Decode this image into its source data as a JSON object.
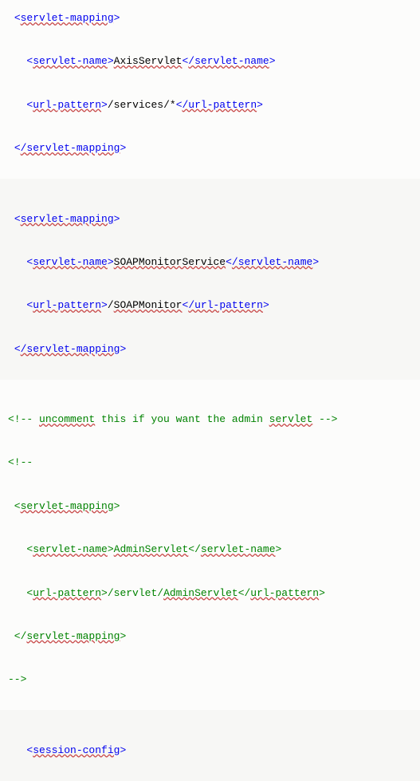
{
  "block1": {
    "open_sm": "servlet-mapping",
    "open_sn": "servlet-name",
    "sn_val": "AxisServlet",
    "close_sn": "/servlet-name",
    "open_up": "url-pattern",
    "up_val": "/services/*",
    "close_up": "/url-pattern",
    "close_sm": "/servlet-mapping"
  },
  "block2": {
    "open_sm": "servlet-mapping",
    "open_sn": "servlet-name",
    "sn_val": "SOAPMonitorService",
    "close_sn": "/servlet-name",
    "open_up": "url-pattern",
    "up_val_slash": "/",
    "up_val": "SOAPMonitor",
    "close_up": "/url-pattern",
    "close_sm": "/servlet-mapping"
  },
  "block3": {
    "cmt_open": "<!-- ",
    "cmt_word1": "uncomment",
    "cmt_mid": " this if you want the admin ",
    "cmt_word2": "servlet",
    "cmt_close": " -->",
    "start": "<!--",
    "l_open_sm": " <",
    "l_open_sm2": "servlet-mapping",
    "l_open_sm3": ">",
    "l_open_sn": "   <",
    "l_open_sn2": "servlet-name",
    "l_open_sn3": ">",
    "sn_val": "AdminServlet",
    "l_close_sn": "</",
    "l_close_sn2": "servlet-name",
    "l_close_sn3": ">",
    "l_open_up": "   <",
    "l_open_up2": "url-pattern",
    "l_open_up3": ">/servlet/",
    "up_val": "AdminServlet",
    "l_close_up": "</",
    "l_close_up2": "url-pattern",
    "l_close_up3": ">",
    "l_close_sm": " </",
    "l_close_sm2": "servlet-mapping",
    "l_close_sm3": ">",
    "end": "-->"
  },
  "block4": {
    "open_sc": "session-config"
  }
}
